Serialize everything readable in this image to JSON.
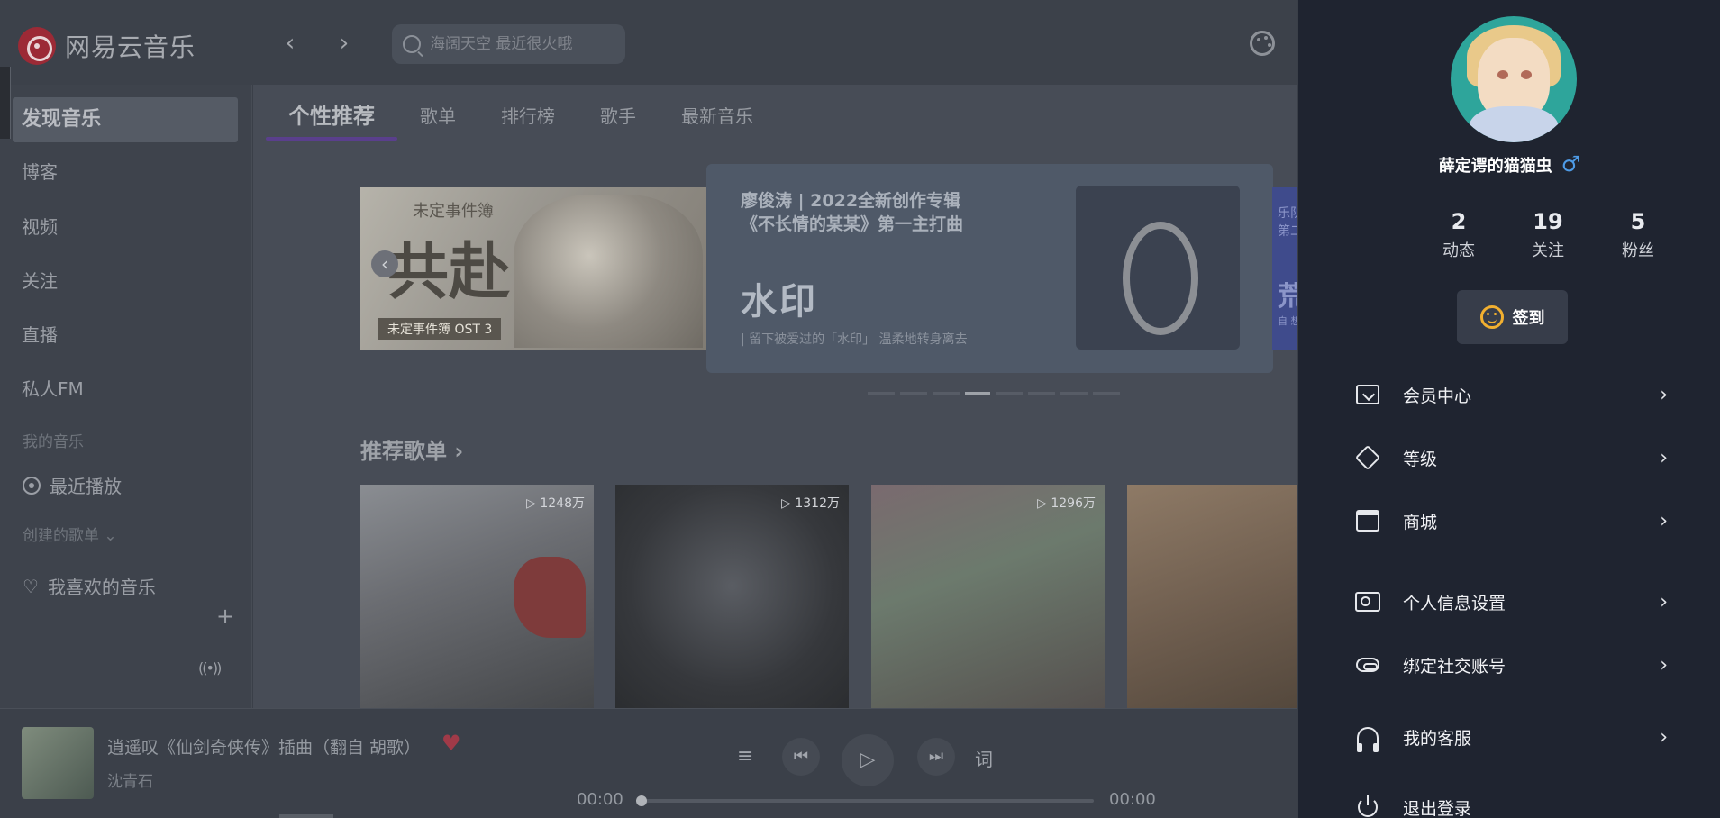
{
  "app": {
    "name": "网易云音乐",
    "search_placeholder": "海阔天空 最近很火哦"
  },
  "sidebar": {
    "discover": "发现音乐",
    "items": [
      "博客",
      "视频",
      "关注",
      "直播",
      "私人FM"
    ],
    "my_music_header": "我的音乐",
    "recent": "最近播放",
    "created_playlists": "创建的歌单",
    "liked": "我喜欢的音乐"
  },
  "tabs": [
    "个性推荐",
    "歌单",
    "排行榜",
    "歌手",
    "最新音乐"
  ],
  "banners": {
    "left": {
      "top_text": "未定事件簿",
      "big_text": "共赴",
      "bottom_text": "未定事件簿 OST 3"
    },
    "mid": {
      "line1": "廖俊涛 | 2022全新创作专辑",
      "line2": "《不长情的某某》第一主打曲",
      "title": "水印",
      "caption": "| 留下被爱过的「水印」 温柔地转身离去"
    },
    "right": {
      "line1": "乐队",
      "line2": "第二",
      "big": "荒",
      "line3": "自 想"
    },
    "dot_count": 8,
    "active_dot": 3
  },
  "recommended": {
    "title": "推荐歌单",
    "cards": [
      {
        "count": "1248万"
      },
      {
        "count": "1312万"
      },
      {
        "count": "1296万"
      },
      {
        "count": ""
      }
    ]
  },
  "player": {
    "song": "逍遥叹《仙剑奇侠传》插曲（翻自 胡歌）",
    "artist": "沈青石",
    "time_current": "00:00",
    "time_total": "00:00",
    "lyrics_label": "词",
    "progress": 0
  },
  "user_panel": {
    "username": "薛定谔的猫猫虫",
    "gender_symbol": "♂",
    "stats": [
      {
        "value": "2",
        "label": "动态"
      },
      {
        "value": "19",
        "label": "关注"
      },
      {
        "value": "5",
        "label": "粉丝"
      }
    ],
    "signin_label": "签到",
    "menu": [
      {
        "label": "会员中心",
        "icon": "vip-box-icon"
      },
      {
        "label": "等级",
        "icon": "diamond-icon"
      },
      {
        "label": "商城",
        "icon": "store-icon"
      },
      {
        "label": "个人信息设置",
        "icon": "profile-card-icon"
      },
      {
        "label": "绑定社交账号",
        "icon": "link-icon"
      },
      {
        "label": "我的客服",
        "icon": "headset-icon"
      },
      {
        "label": "退出登录",
        "icon": "power-icon"
      }
    ]
  },
  "colors": {
    "accent_red": "#9c2a36",
    "tab_underline": "#5a3f8c",
    "panel_bg": "#1f2430",
    "gender_blue": "#4e9be6",
    "signin_yellow": "#f2b030"
  }
}
